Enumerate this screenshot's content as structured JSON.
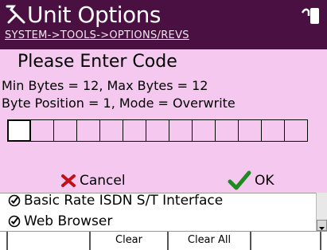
{
  "header": {
    "title": "Unit Options",
    "breadcrumb": "SYSTEM->TOOLS->OPTIONS/REVS",
    "title_icon": "tools-icon",
    "status_icon": "plug-icon",
    "background": "#4a1042"
  },
  "dialog": {
    "title": "Please Enter Code",
    "info_line_1": "Min Bytes = 12, Max Bytes = 12",
    "info_line_2": "Byte Position = 1, Mode = Overwrite",
    "code_slots": 13,
    "active_slot": 1,
    "background": "#f5c8f0",
    "cancel_label": "Cancel",
    "ok_label": "OK"
  },
  "list": {
    "items": [
      {
        "label": "Basic Rate ISDN S/T Interface",
        "icon": "check-circle-icon"
      },
      {
        "label": "Web Browser",
        "icon": "check-circle-icon"
      }
    ]
  },
  "softkeys": {
    "clear_label": "Clear",
    "clear_all_label": "Clear All"
  }
}
